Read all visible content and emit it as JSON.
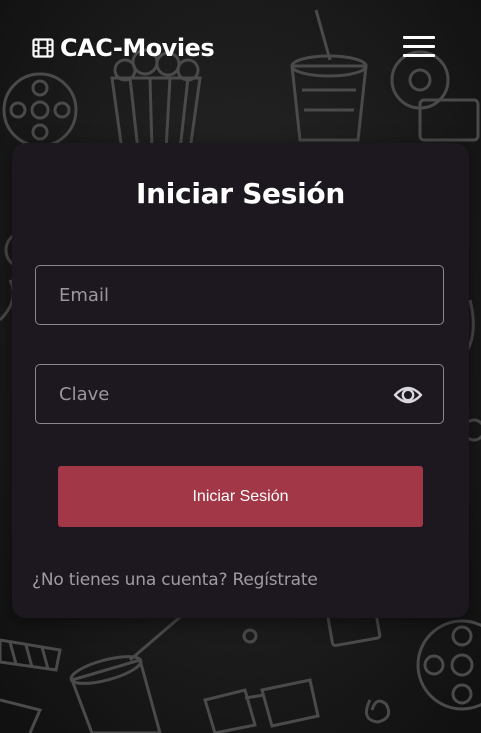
{
  "navbar": {
    "brand_icon": "film-icon",
    "brand_name": "CAC-Movies",
    "menu_icon": "hamburger-menu-icon"
  },
  "login": {
    "title": "Iniciar Sesión",
    "email_placeholder": "Email",
    "email_value": "",
    "password_placeholder": "Clave",
    "password_value": "",
    "toggle_icon": "eye-icon",
    "submit_label": "Iniciar Sesión",
    "register_prompt": "¿No tienes una cuenta?",
    "register_link": "Regístrate"
  },
  "background": {
    "pattern": "cinema-doodle-pattern"
  },
  "colors": {
    "page_background": "#1a1a1a",
    "card_background": "#1d181f",
    "accent": "#a23748",
    "field_border": "#8a8690",
    "muted_text": "#9f9ba3"
  }
}
